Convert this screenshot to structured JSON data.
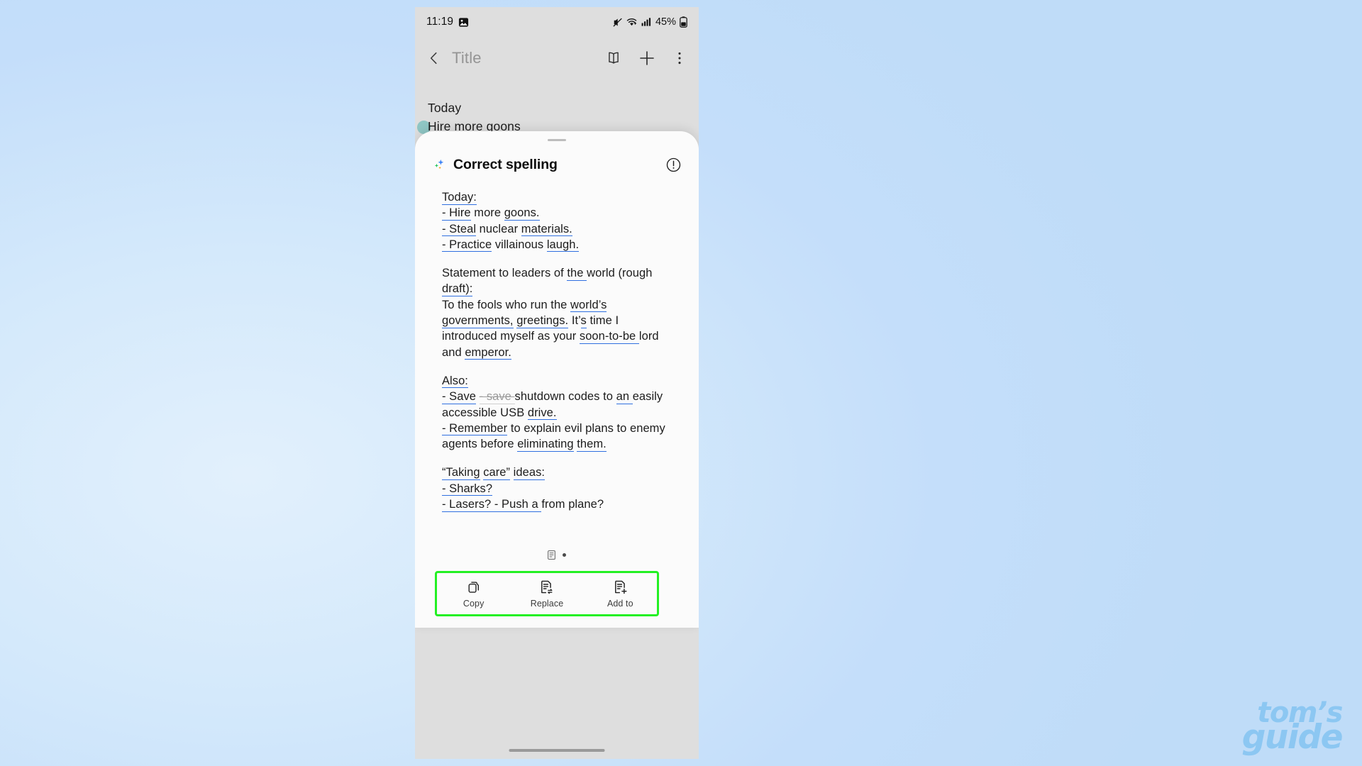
{
  "status_bar": {
    "time": "11:19",
    "battery_percent": "45%",
    "icons": [
      "gallery-icon",
      "mute-icon",
      "wifi-icon",
      "signal-icon",
      "battery-icon"
    ]
  },
  "nav_bar": {
    "back_label": "back",
    "title": "Title",
    "actions": [
      "book-icon",
      "plus-icon",
      "more-vertical-icon"
    ]
  },
  "note": {
    "date_label": "Today",
    "first_line": "Hire more goons"
  },
  "sheet": {
    "title": "Correct spelling",
    "leading_icon": "ai-sparkle-icon",
    "info_icon": "info-circle-icon",
    "paragraphs": [
      {
        "lines": [
          [
            {
              "t": "Today:",
              "s": "c"
            }
          ],
          [
            {
              "t": "- Hire",
              "s": "c"
            },
            {
              "t": " more ",
              "s": "n"
            },
            {
              "t": "goons.",
              "s": "c"
            }
          ],
          [
            {
              "t": "- Steal",
              "s": "c"
            },
            {
              "t": " nuclear ",
              "s": "n"
            },
            {
              "t": "materials.",
              "s": "c"
            }
          ],
          [
            {
              "t": "- Practice",
              "s": "c"
            },
            {
              "t": " villainous ",
              "s": "n"
            },
            {
              "t": "laugh.",
              "s": "c"
            }
          ]
        ]
      },
      {
        "lines": [
          [
            {
              "t": "Statement to leaders of ",
              "s": "n"
            },
            {
              "t": "the ",
              "s": "c"
            },
            {
              "t": "world (rough",
              "s": "n"
            }
          ],
          [
            {
              "t": "draft):",
              "s": "c"
            }
          ],
          [
            {
              "t": "To the fools who run the ",
              "s": "n"
            },
            {
              "t": "world’s",
              "s": "c"
            }
          ],
          [
            {
              "t": "governments,",
              "s": "c"
            },
            {
              "t": " ",
              "s": "n"
            },
            {
              "t": "greetings.",
              "s": "c"
            },
            {
              "t": " It’",
              "s": "n"
            },
            {
              "t": "s",
              "s": "c"
            },
            {
              "t": " time I",
              "s": "n"
            }
          ],
          [
            {
              "t": "introduced myself as your ",
              "s": "n"
            },
            {
              "t": "soon-to-be ",
              "s": "c"
            },
            {
              "t": "lord",
              "s": "n"
            }
          ],
          [
            {
              "t": "and ",
              "s": "n"
            },
            {
              "t": "emperor.",
              "s": "c"
            }
          ]
        ]
      },
      {
        "lines": [
          [
            {
              "t": "Also:",
              "s": "c"
            }
          ],
          [
            {
              "t": "- Save",
              "s": "c"
            },
            {
              "t": " ",
              "s": "n"
            },
            {
              "t": "- save ",
              "s": "d"
            },
            {
              "t": "shutdown codes to ",
              "s": "n"
            },
            {
              "t": "an ",
              "s": "c"
            },
            {
              "t": "easily",
              "s": "n"
            }
          ],
          [
            {
              "t": "accessible USB ",
              "s": "n"
            },
            {
              "t": "drive.",
              "s": "c"
            }
          ],
          [
            {
              "t": "- Remember",
              "s": "c"
            },
            {
              "t": " to explain evil plans to enemy",
              "s": "n"
            }
          ],
          [
            {
              "t": "agents before ",
              "s": "n"
            },
            {
              "t": "eliminating",
              "s": "c"
            },
            {
              "t": " ",
              "s": "n"
            },
            {
              "t": "them.",
              "s": "c"
            }
          ]
        ]
      },
      {
        "lines": [
          [
            {
              "t": "“Taking",
              "s": "c"
            },
            {
              "t": " ",
              "s": "n"
            },
            {
              "t": "care”",
              "s": "c"
            },
            {
              "t": " ",
              "s": "n"
            },
            {
              "t": "ideas:",
              "s": "c"
            }
          ],
          [
            {
              "t": "- Sharks?",
              "s": "c"
            }
          ],
          [
            {
              "t": "- Lasers? - Push a ",
              "s": "c"
            },
            {
              "t": " from plane?",
              "s": "n"
            }
          ]
        ]
      }
    ],
    "page_indicator": {
      "dots": 2,
      "active": 1
    }
  },
  "action_bar": {
    "highlight_color": "#24f024",
    "actions": [
      {
        "label": "Copy",
        "icon": "copy-icon"
      },
      {
        "label": "Replace",
        "icon": "replace-document-icon"
      },
      {
        "label": "Add to",
        "icon": "add-to-document-icon"
      }
    ]
  },
  "watermark": {
    "line1": "tom’s",
    "line2": "guide",
    "color": "#8cc7f2"
  }
}
